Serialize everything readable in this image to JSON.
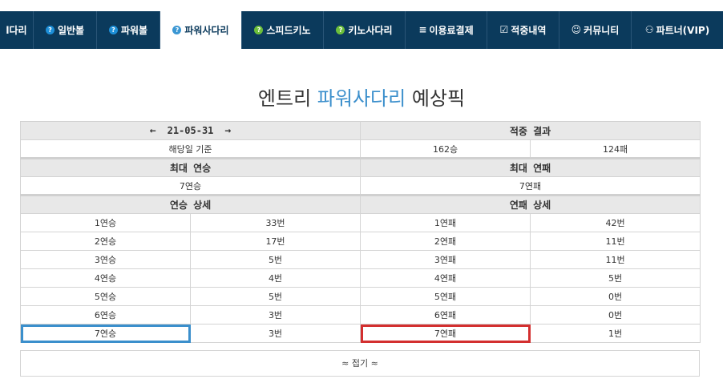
{
  "nav": {
    "items": [
      {
        "label": "l다리",
        "icon": ""
      },
      {
        "label": "일반볼",
        "icon": "?"
      },
      {
        "label": "파워볼",
        "icon": "?"
      },
      {
        "label": "파워사다리",
        "icon": "?"
      },
      {
        "label": "스피드키노",
        "icon": "?"
      },
      {
        "label": "키노사다리",
        "icon": "?"
      },
      {
        "label": "이용료결제",
        "icon": "≡"
      },
      {
        "label": "적중내역",
        "icon": "☑"
      },
      {
        "label": "커뮤니티",
        "icon": "☺"
      },
      {
        "label": "파트너(VIP)",
        "icon": "⚇"
      }
    ]
  },
  "title": {
    "prefix": "엔트리 ",
    "accent": "파워사다리",
    "suffix": " 예상픽"
  },
  "date": {
    "prev_icon": "←",
    "value": "21-05-31",
    "next_icon": "→"
  },
  "result": {
    "header": "적중 결과",
    "basis": "해당일 기준",
    "wins": "162승",
    "losses": "124패"
  },
  "max": {
    "win_header": "최대 연승",
    "loss_header": "최대 연패",
    "win_value": "7연승",
    "loss_value": "7연패"
  },
  "detail": {
    "win_header": "연승 상세",
    "loss_header": "연패 상세",
    "rows": [
      {
        "win_label": "1연승",
        "win_count": "33번",
        "loss_label": "1연패",
        "loss_count": "42번"
      },
      {
        "win_label": "2연승",
        "win_count": "17번",
        "loss_label": "2연패",
        "loss_count": "11번"
      },
      {
        "win_label": "3연승",
        "win_count": "5번",
        "loss_label": "3연패",
        "loss_count": "11번"
      },
      {
        "win_label": "4연승",
        "win_count": "4번",
        "loss_label": "4연패",
        "loss_count": "5번"
      },
      {
        "win_label": "5연승",
        "win_count": "5번",
        "loss_label": "5연패",
        "loss_count": "0번"
      },
      {
        "win_label": "6연승",
        "win_count": "3번",
        "loss_label": "6연패",
        "loss_count": "0번"
      },
      {
        "win_label": "7연승",
        "win_count": "3번",
        "loss_label": "7연패",
        "loss_count": "1번"
      }
    ]
  },
  "fold": {
    "label": "접기",
    "icon": "≈"
  },
  "colors": {
    "nav_bg": "#0b3a5c",
    "accent": "#3b8fcc",
    "highlight_blue": "#3b8fcc",
    "highlight_red": "#d32f2f"
  }
}
